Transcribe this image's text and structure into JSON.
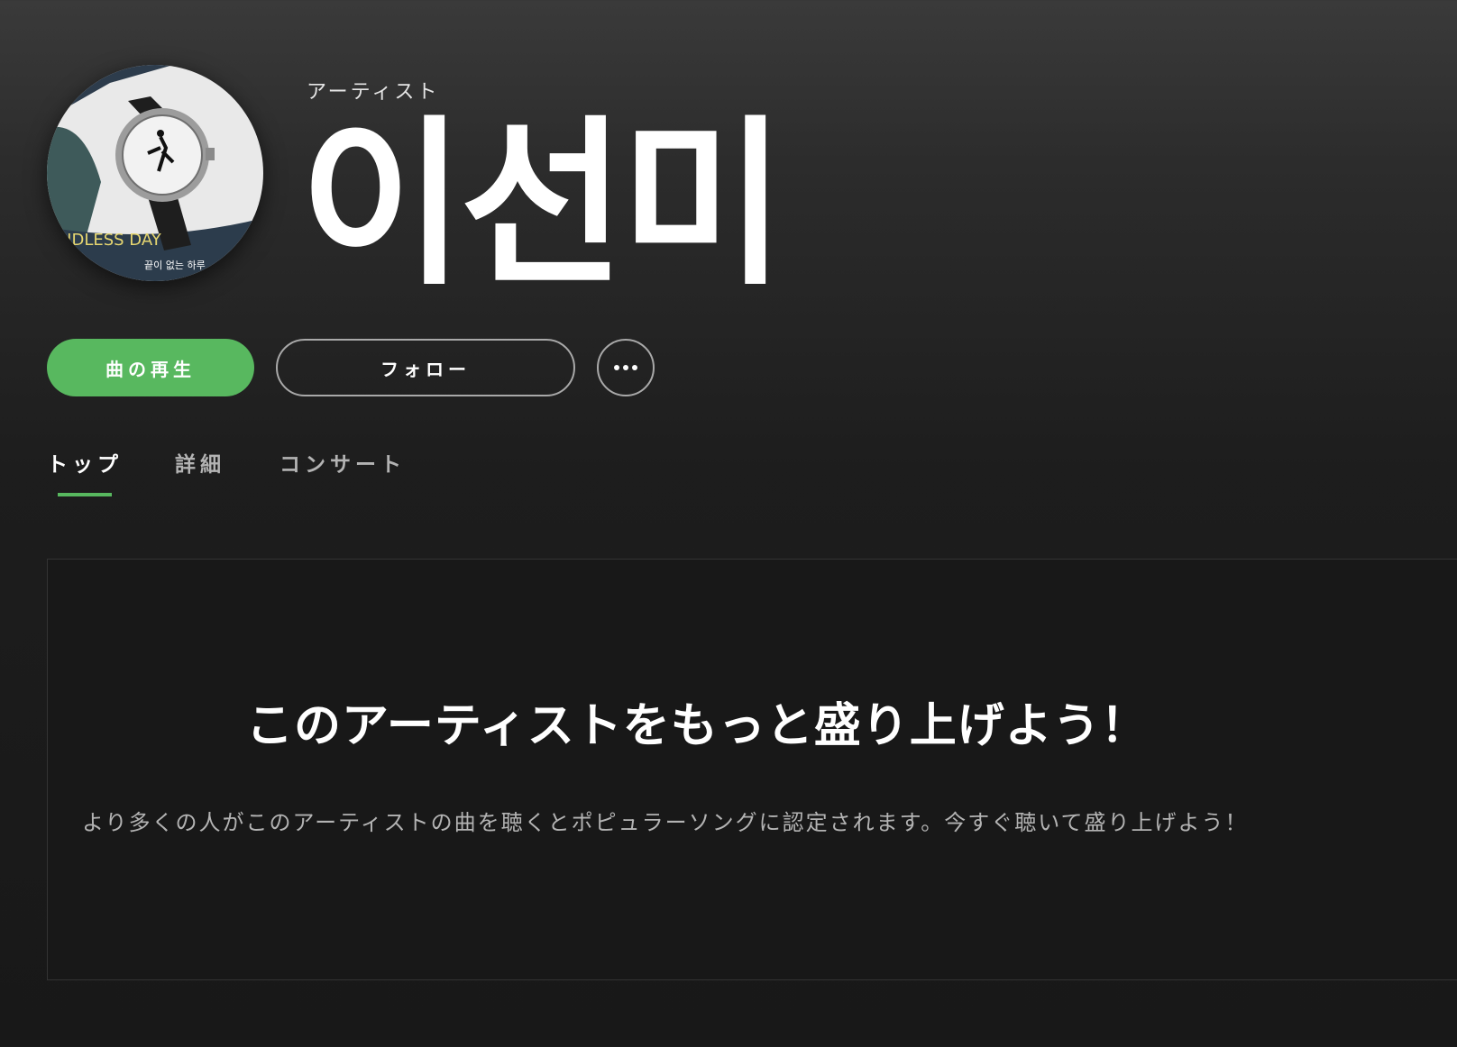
{
  "artist": {
    "type_label": "アーティスト",
    "name": "이선미",
    "avatar": {
      "icon": "album-art-wristwatch",
      "art_text_english": "NDLESS DAY",
      "art_text_korean": "끝이 없는 하루"
    }
  },
  "actions": {
    "play_label": "曲の再生",
    "follow_label": "フォロー",
    "more_icon": "more-dots-icon"
  },
  "tabs": [
    {
      "label": "トップ",
      "active": true
    },
    {
      "label": "詳細",
      "active": false
    },
    {
      "label": "コンサート",
      "active": false
    }
  ],
  "promo": {
    "title": "このアーティストをもっと盛り上げよう！",
    "description": "より多くの人がこのアーティストの曲を聴くとポピュラーソングに認定されます。今すぐ聴いて盛り上げよう！"
  },
  "colors": {
    "accent": "#58b85f",
    "background": "#181818",
    "text_primary": "#ffffff",
    "text_secondary": "#b3b3b3"
  }
}
